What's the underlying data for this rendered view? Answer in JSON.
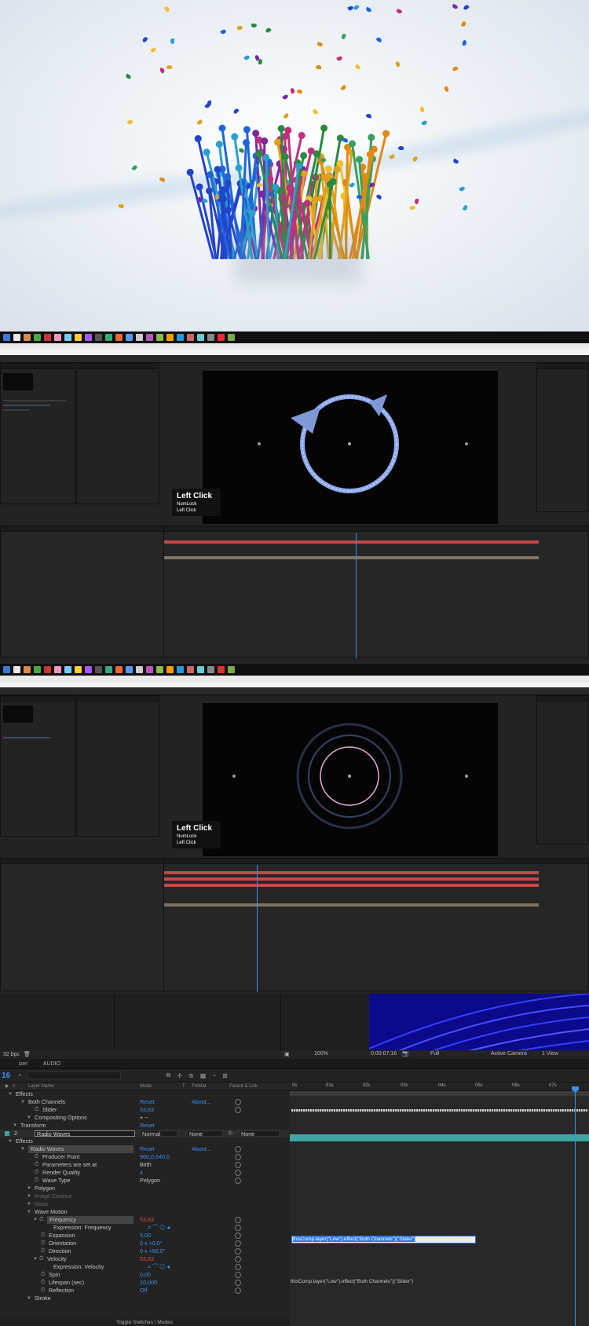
{
  "overlay": {
    "left_click": "Left Click",
    "numlock": "NumLock",
    "left_click_small": "Left Click"
  },
  "viewer_bar": {
    "zoom": "100%",
    "timecode": "0:00:07:16",
    "resolution": "Full",
    "camera": "Active Camera",
    "view": "1 View",
    "fps": "32 bpc"
  },
  "tabs": [
    "izer",
    "AUDIO"
  ],
  "comp_label": "16",
  "columns": {
    "layer_name": "Layer Name",
    "mode": "Mode",
    "t": "T",
    "trkmat": "TrkMat",
    "parent": "Parent & Link"
  },
  "ruler_ticks": [
    "0s",
    "01s",
    "02s",
    "03s",
    "04s",
    "05s",
    "06s",
    "07s"
  ],
  "layers": {
    "effects": "Effects",
    "both_channels": "Both Channels",
    "slider": "Slider",
    "slider_value": "53,63",
    "compositing_options": "Compositing Options",
    "reset": "Reset",
    "about": "About...",
    "transform": "Transform",
    "transform_reset": "Reset",
    "layer_number": "2",
    "layer_name": "Radio Waves",
    "layer_mode": "Normal",
    "trkmat": "None",
    "parent": "None",
    "effects2": "Effects",
    "radio_waves": "Radio Waves",
    "rw_reset": "Reset",
    "rw_about": "About...",
    "producer_point": "Producer Point",
    "producer_point_value": "960,0,540,0",
    "parameters_set_at": "Parameters are set at",
    "parameters_set_at_value": "Birth",
    "render_quality": "Render Quality",
    "render_quality_value": "4",
    "wave_type": "Wave Type",
    "wave_type_value": "Polygon",
    "polygon": "Polygon",
    "image_contour": "Image Contour",
    "mask": "Mask",
    "wave_motion": "Wave Motion",
    "frequency": "Frequency",
    "frequency_value": "53,63",
    "expression_frequency": "Expression: Frequency",
    "expansion": "Expansion",
    "expansion_value": "5,00",
    "orientation": "Orientation",
    "orientation_value": "0 x +0,0°",
    "direction": "Direction",
    "direction_value": "0 x +90,0°",
    "velocity": "Velocity",
    "velocity_value": "53,63",
    "expression_velocity": "Expression: Velocity",
    "spin": "Spin",
    "spin_value": "0,00",
    "lifespan": "Lifespan (sec)",
    "lifespan_value": "10,000",
    "reflection": "Reflection",
    "reflection_value": "Off",
    "stroke": "Stroke"
  },
  "expression_freq_text": "thisComp.layer(\"Low\").effect(\"Both Channels\")(\"Slider\")",
  "expression_vel_text": "thisComp.layer(\"Low\").effect(\"Both Channels\")(\"Slider\")",
  "footer": "Toggle Switches / Modes",
  "colors": {
    "accent_blue": "#3a8ff0",
    "keyframe_red": "#e04848",
    "layer_teal": "#3fa7a0"
  }
}
